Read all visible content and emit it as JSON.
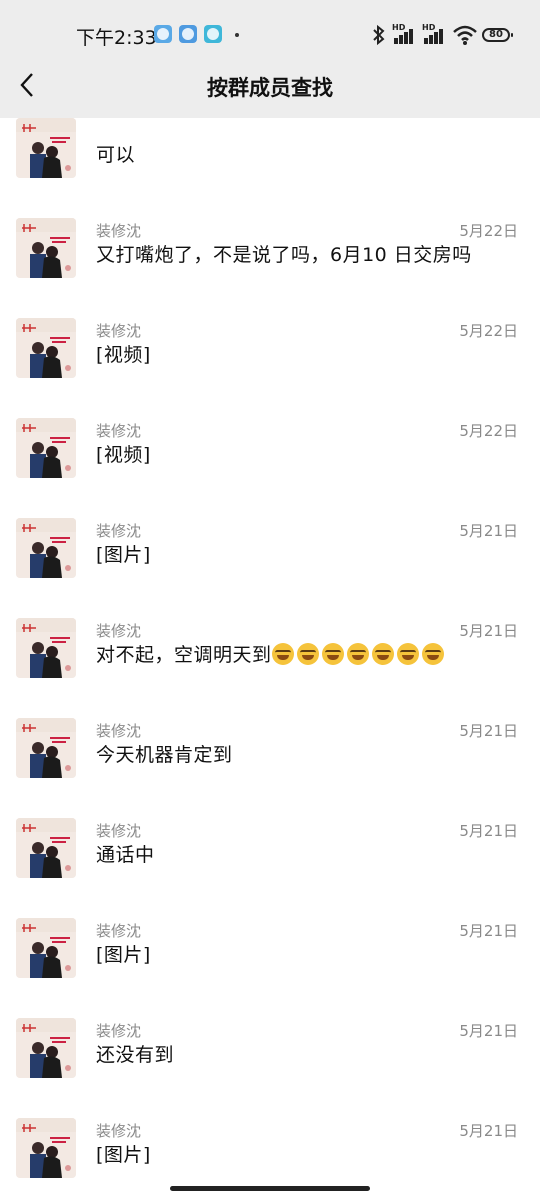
{
  "status_bar": {
    "time": "下午2:33",
    "battery": "80"
  },
  "header": {
    "title": "按群成员查找"
  },
  "messages": [
    {
      "sender": "",
      "date": "",
      "text": "可以"
    },
    {
      "sender": "装修沈",
      "date": "5月22日",
      "text": "又打嘴炮了，不是说了吗，6月10 日交房吗"
    },
    {
      "sender": "装修沈",
      "date": "5月22日",
      "text": "[视频]"
    },
    {
      "sender": "装修沈",
      "date": "5月22日",
      "text": "[视频]"
    },
    {
      "sender": "装修沈",
      "date": "5月21日",
      "text": "[图片]"
    },
    {
      "sender": "装修沈",
      "date": "5月21日",
      "text": "对不起，空调明天到",
      "emoji_count": 7,
      "emoji": "laughing-crying-emoji"
    },
    {
      "sender": "装修沈",
      "date": "5月21日",
      "text": "今天机器肯定到"
    },
    {
      "sender": "装修沈",
      "date": "5月21日",
      "text": "通话中"
    },
    {
      "sender": "装修沈",
      "date": "5月21日",
      "text": "[图片]"
    },
    {
      "sender": "装修沈",
      "date": "5月21日",
      "text": "还没有到"
    },
    {
      "sender": "装修沈",
      "date": "5月21日",
      "text": "[图片]"
    }
  ],
  "colors": {
    "header_bg": "#ededed",
    "meta_text": "#8a8a8a",
    "body_text": "#111111"
  }
}
